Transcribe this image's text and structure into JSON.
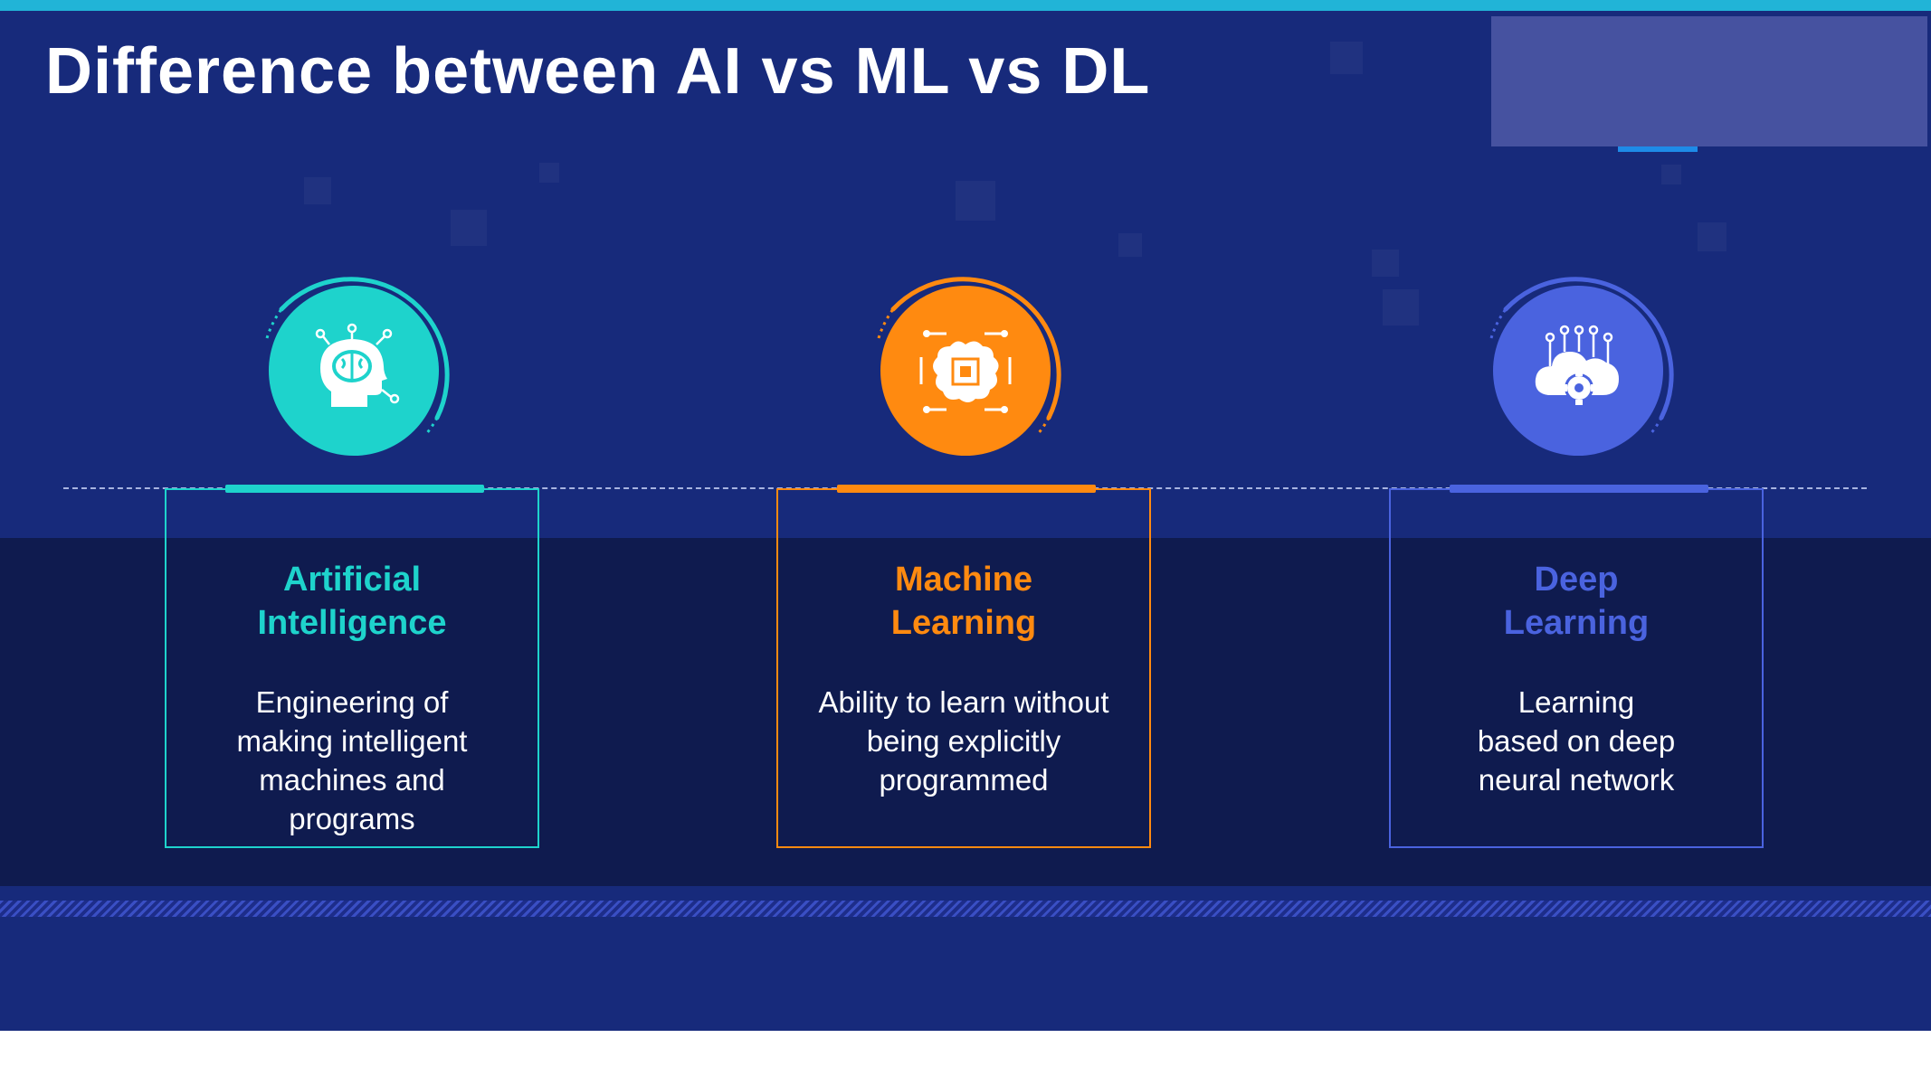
{
  "slide": {
    "title": "Difference between AI vs ML vs DL"
  },
  "colors": {
    "background": "#172a7b",
    "band": "#0f1b4f",
    "ai_accent": "#1ed3cc",
    "ml_accent": "#ff8a10",
    "dl_accent": "#4a63df"
  },
  "cards": [
    {
      "title_line1": "Artificial",
      "title_line2": "Intelligence",
      "desc_line1": "Engineering of",
      "desc_line2": "making intelligent",
      "desc_line3": "machines and",
      "desc_line4": "programs",
      "icon": "brain-head-icon"
    },
    {
      "title_line1": "Machine",
      "title_line2": "Learning",
      "desc_line1": "Ability to learn without",
      "desc_line2": "being explicitly",
      "desc_line3": "programmed",
      "icon": "cpu-brain-icon"
    },
    {
      "title_line1": "Deep",
      "title_line2": "Learning",
      "desc_line1": "Learning",
      "desc_line2": "based on deep",
      "desc_line3": "neural network",
      "icon": "cloud-gear-icon"
    }
  ]
}
